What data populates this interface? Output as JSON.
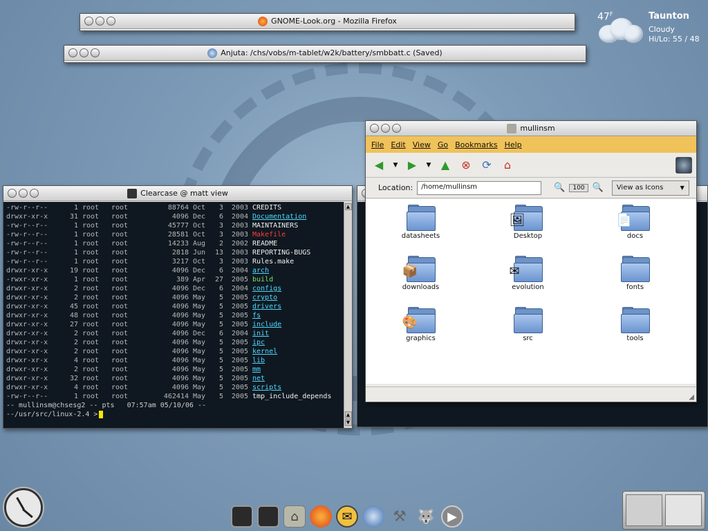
{
  "windows": {
    "firefox": {
      "title": "GNOME-Look.org - Mozilla Firefox"
    },
    "anjuta": {
      "title": "Anjuta: /chs/vobs/m-tablet/w2k/battery/smbbatt.c (Saved)"
    },
    "terminal": {
      "title": "Clearcase @ matt view",
      "rows": [
        {
          "perm": "-rw-r--r--",
          "n": "1",
          "u": "root",
          "g": "root",
          "size": "88764",
          "mon": "Oct",
          "day": "3",
          "yr": "2003",
          "name": "CREDITS",
          "kind": "plain"
        },
        {
          "perm": "drwxr-xr-x",
          "n": "31",
          "u": "root",
          "g": "root",
          "size": "4096",
          "mon": "Dec",
          "day": "6",
          "yr": "2004",
          "name": "Documentation",
          "kind": "dir"
        },
        {
          "perm": "-rw-r--r--",
          "n": "1",
          "u": "root",
          "g": "root",
          "size": "45777",
          "mon": "Oct",
          "day": "3",
          "yr": "2003",
          "name": "MAINTAINERS",
          "kind": "plain"
        },
        {
          "perm": "-rw-r--r--",
          "n": "1",
          "u": "root",
          "g": "root",
          "size": "28581",
          "mon": "Oct",
          "day": "3",
          "yr": "2003",
          "name": "Makefile",
          "kind": "mk"
        },
        {
          "perm": "-rw-r--r--",
          "n": "1",
          "u": "root",
          "g": "root",
          "size": "14233",
          "mon": "Aug",
          "day": "2",
          "yr": "2002",
          "name": "README",
          "kind": "plain"
        },
        {
          "perm": "-rw-r--r--",
          "n": "1",
          "u": "root",
          "g": "root",
          "size": "2818",
          "mon": "Jun",
          "day": "13",
          "yr": "2003",
          "name": "REPORTING-BUGS",
          "kind": "plain"
        },
        {
          "perm": "-rw-r--r--",
          "n": "1",
          "u": "root",
          "g": "root",
          "size": "3217",
          "mon": "Oct",
          "day": "3",
          "yr": "2003",
          "name": "Rules.make",
          "kind": "plain"
        },
        {
          "perm": "drwxr-xr-x",
          "n": "19",
          "u": "root",
          "g": "root",
          "size": "4096",
          "mon": "Dec",
          "day": "6",
          "yr": "2004",
          "name": "arch",
          "kind": "dir"
        },
        {
          "perm": "-rwxr-xr-x",
          "n": "1",
          "u": "root",
          "g": "root",
          "size": "389",
          "mon": "Apr",
          "day": "27",
          "yr": "2005",
          "name": "build",
          "kind": "exe"
        },
        {
          "perm": "drwxr-xr-x",
          "n": "2",
          "u": "root",
          "g": "root",
          "size": "4096",
          "mon": "Dec",
          "day": "6",
          "yr": "2004",
          "name": "configs",
          "kind": "dir"
        },
        {
          "perm": "drwxr-xr-x",
          "n": "2",
          "u": "root",
          "g": "root",
          "size": "4096",
          "mon": "May",
          "day": "5",
          "yr": "2005",
          "name": "crypto",
          "kind": "dir"
        },
        {
          "perm": "drwxr-xr-x",
          "n": "45",
          "u": "root",
          "g": "root",
          "size": "4096",
          "mon": "May",
          "day": "5",
          "yr": "2005",
          "name": "drivers",
          "kind": "dir"
        },
        {
          "perm": "drwxr-xr-x",
          "n": "48",
          "u": "root",
          "g": "root",
          "size": "4096",
          "mon": "May",
          "day": "5",
          "yr": "2005",
          "name": "fs",
          "kind": "dir"
        },
        {
          "perm": "drwxr-xr-x",
          "n": "27",
          "u": "root",
          "g": "root",
          "size": "4096",
          "mon": "May",
          "day": "5",
          "yr": "2005",
          "name": "include",
          "kind": "dir"
        },
        {
          "perm": "drwxr-xr-x",
          "n": "2",
          "u": "root",
          "g": "root",
          "size": "4096",
          "mon": "Dec",
          "day": "6",
          "yr": "2004",
          "name": "init",
          "kind": "dir"
        },
        {
          "perm": "drwxr-xr-x",
          "n": "2",
          "u": "root",
          "g": "root",
          "size": "4096",
          "mon": "May",
          "day": "5",
          "yr": "2005",
          "name": "ipc",
          "kind": "dir"
        },
        {
          "perm": "drwxr-xr-x",
          "n": "2",
          "u": "root",
          "g": "root",
          "size": "4096",
          "mon": "May",
          "day": "5",
          "yr": "2005",
          "name": "kernel",
          "kind": "dir"
        },
        {
          "perm": "drwxr-xr-x",
          "n": "4",
          "u": "root",
          "g": "root",
          "size": "4096",
          "mon": "May",
          "day": "5",
          "yr": "2005",
          "name": "lib",
          "kind": "dir"
        },
        {
          "perm": "drwxr-xr-x",
          "n": "2",
          "u": "root",
          "g": "root",
          "size": "4096",
          "mon": "May",
          "day": "5",
          "yr": "2005",
          "name": "mm",
          "kind": "dir"
        },
        {
          "perm": "drwxr-xr-x",
          "n": "32",
          "u": "root",
          "g": "root",
          "size": "4096",
          "mon": "May",
          "day": "5",
          "yr": "2005",
          "name": "net",
          "kind": "dir"
        },
        {
          "perm": "drwxr-xr-x",
          "n": "4",
          "u": "root",
          "g": "root",
          "size": "4096",
          "mon": "May",
          "day": "5",
          "yr": "2005",
          "name": "scripts",
          "kind": "dir"
        },
        {
          "perm": "-rw-r--r--",
          "n": "1",
          "u": "root",
          "g": "root",
          "size": "462414",
          "mon": "May",
          "day": "5",
          "yr": "2005",
          "name": "tmp_include_depends",
          "kind": "plain"
        }
      ],
      "prompt_line1": "-- mullinsm@chsesg2 -- pts   07:57am 05/10/06 --",
      "prompt_line2": "--/usr/src/linux-2.4 >"
    },
    "nautilus": {
      "title": "mullinsm",
      "menu": [
        "File",
        "Edit",
        "View",
        "Go",
        "Bookmarks",
        "Help"
      ],
      "location_label": "Location:",
      "location_value": "/home/mullinsm",
      "zoom": "100",
      "view_as": "View as Icons",
      "items": [
        {
          "label": "datasheets",
          "emblem": ""
        },
        {
          "label": "Desktop",
          "emblem": "🖼"
        },
        {
          "label": "docs",
          "emblem": "📄"
        },
        {
          "label": "downloads",
          "emblem": "📦"
        },
        {
          "label": "evolution",
          "emblem": "✉"
        },
        {
          "label": "fonts",
          "emblem": ""
        },
        {
          "label": "graphics",
          "emblem": "🎨"
        },
        {
          "label": "src",
          "emblem": ""
        },
        {
          "label": "tools",
          "emblem": ""
        }
      ]
    }
  },
  "weather": {
    "temp": "47",
    "unit": "F",
    "city": "Taunton",
    "cond": "Cloudy",
    "hilo": "Hi/Lo: 55 / 48"
  },
  "dock": [
    "terminal-icon",
    "terminal-icon",
    "home-folder-icon",
    "firefox-icon",
    "mail-icon",
    "anjuta-icon",
    "hammer-icon",
    "gimp-icon",
    "play-icon"
  ]
}
